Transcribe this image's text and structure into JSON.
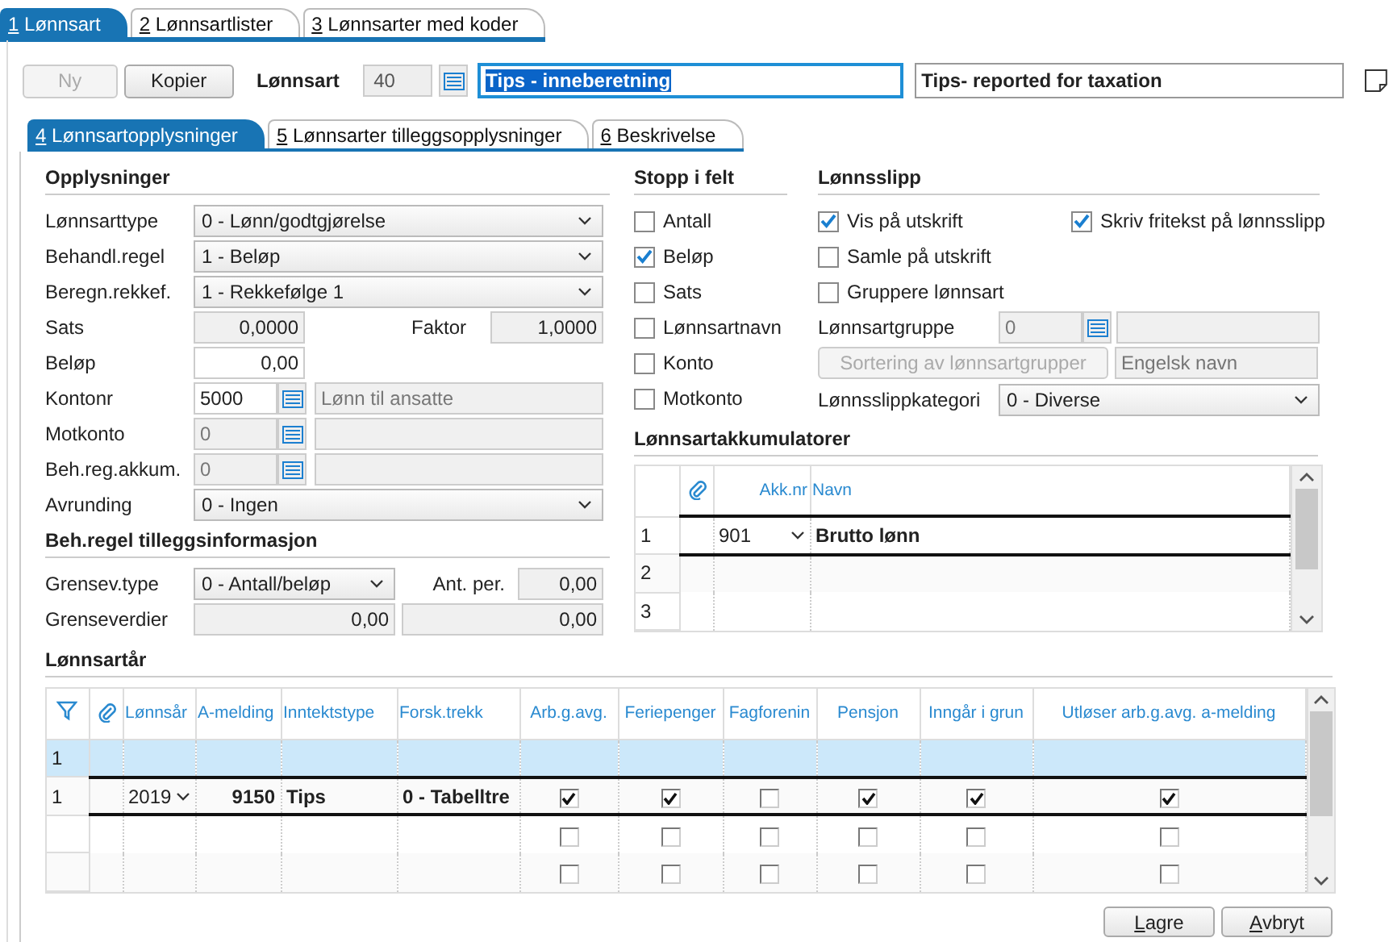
{
  "tabs": [
    {
      "key": "1",
      "label": "Lønnsart",
      "selected": true
    },
    {
      "key": "2",
      "label": "Lønnsartlister",
      "selected": false
    },
    {
      "key": "3",
      "label": "Lønnsarter med koder",
      "selected": false
    }
  ],
  "toolbar": {
    "buttons": [
      {
        "label": "Ny",
        "disabled": true
      },
      {
        "label": "Kopier",
        "disabled": false
      }
    ],
    "label": "Lønnsart",
    "number": "40",
    "name": "Tips - inneberetning",
    "name_text_selected": true,
    "english_name": "Tips- reported for taxation"
  },
  "subtabs": [
    {
      "key": "4",
      "label": "Lønnsartopplysninger",
      "selected": true
    },
    {
      "key": "5",
      "label": "Lønnsarter tilleggsopplysninger",
      "selected": false
    },
    {
      "key": "6",
      "label": "Beskrivelse",
      "selected": false
    }
  ],
  "opplysninger": {
    "title": "Opplysninger",
    "rows": [
      {
        "kind": "select",
        "label": "Lønnsarttype",
        "value": "0 - Lønn/godtgjørelse"
      },
      {
        "kind": "select",
        "label": "Behandl.regel",
        "value": "1 - Beløp"
      },
      {
        "kind": "select",
        "label": "Beregn.rekkef.",
        "value": "1 - Rekkefølge 1"
      },
      {
        "kind": "pair",
        "label": "Sats",
        "value": "0,0000",
        "disabled": true,
        "label2": "Faktor",
        "value2": "1,0000"
      },
      {
        "kind": "number",
        "label": "Beløp",
        "value": "0,00",
        "disabled": false
      },
      {
        "kind": "lookup",
        "label": "Kontonr",
        "value": "5000",
        "disabled": false,
        "description": "Lønn til ansatte"
      },
      {
        "kind": "lookup",
        "label": "Motkonto",
        "value": "0",
        "disabled": true
      },
      {
        "kind": "lookup",
        "label": "Beh.reg.akkum.",
        "value": "0",
        "disabled": true
      },
      {
        "kind": "select",
        "label": "Avrunding",
        "value": "0 - Ingen"
      }
    ]
  },
  "tillegg": {
    "title": "Beh.regel tilleggsinformasjon",
    "rows": [
      {
        "kind": "select-pair",
        "label": "Grensev.type",
        "value": "0 - Antall/beløp",
        "label2": "Ant. per.",
        "value2": "0,00"
      },
      {
        "kind": "two",
        "label": "Grenseverdier",
        "value": "0,00",
        "value2": "0,00"
      }
    ]
  },
  "stopp": {
    "title": "Stopp i felt",
    "items": [
      {
        "label": "Antall",
        "checked": false
      },
      {
        "label": "Beløp",
        "checked": true
      },
      {
        "label": "Sats",
        "checked": false
      },
      {
        "label": "Lønnsartnavn",
        "checked": false
      },
      {
        "label": "Konto",
        "checked": false
      },
      {
        "label": "Motkonto",
        "checked": false
      }
    ]
  },
  "lonnsslipp": {
    "title": "Lønnsslipp",
    "checks": [
      {
        "label": "Vis på utskrift",
        "checked": true
      },
      {
        "label": "Samle på utskrift",
        "checked": false
      },
      {
        "label": "Gruppere lønnsart",
        "checked": false
      }
    ],
    "side_check": {
      "label": "Skriv fritekst på lønnsslipp",
      "checked": true
    },
    "group": {
      "label": "Lønnsartgruppe",
      "value": "0"
    },
    "sort_button": {
      "label": "Sortering av lønnsartgrupper",
      "disabled": true
    },
    "english_field": {
      "placeholder": "Engelsk navn"
    },
    "category": {
      "label": "Lønnsslippkategori",
      "value": "0 - Diverse"
    }
  },
  "akkumulatorer": {
    "title": "Lønnsartakkumulatorer",
    "columns": [
      "Akk.nr",
      "Navn"
    ],
    "rows": [
      {
        "number": "1",
        "akk": "901",
        "name": "Brutto lønn",
        "selected": true
      },
      {
        "number": "2",
        "selected": false
      },
      {
        "number": "3",
        "selected": false
      }
    ]
  },
  "years": {
    "title": "Lønnsartår",
    "columns": [
      "Lønnsår",
      "A-melding",
      "Inntektstype",
      "Forsk.trekk",
      "Arb.g.avg.",
      "Feriepenger",
      "Fagforenin",
      "Pensjon",
      "Inngår i grun",
      "Utløser arb.g.avg. a-melding"
    ],
    "rows": [
      {
        "kind": "new",
        "number": "1",
        "selected": false
      },
      {
        "kind": "data",
        "number": "1",
        "year": "2019",
        "amelding": "9150",
        "type": "Tips",
        "trekk": "0 - Tabelltre",
        "checks": [
          true,
          true,
          false,
          true,
          true,
          true
        ],
        "selected": true
      },
      {
        "kind": "empty",
        "checks": [
          false,
          false,
          false,
          false,
          false,
          false
        ],
        "selected": false
      },
      {
        "kind": "empty",
        "checks": [
          false,
          false,
          false,
          false,
          false,
          false
        ],
        "selected": false
      }
    ]
  },
  "buttons": [
    {
      "label": "Lagre"
    },
    {
      "label": "Avbryt"
    }
  ]
}
